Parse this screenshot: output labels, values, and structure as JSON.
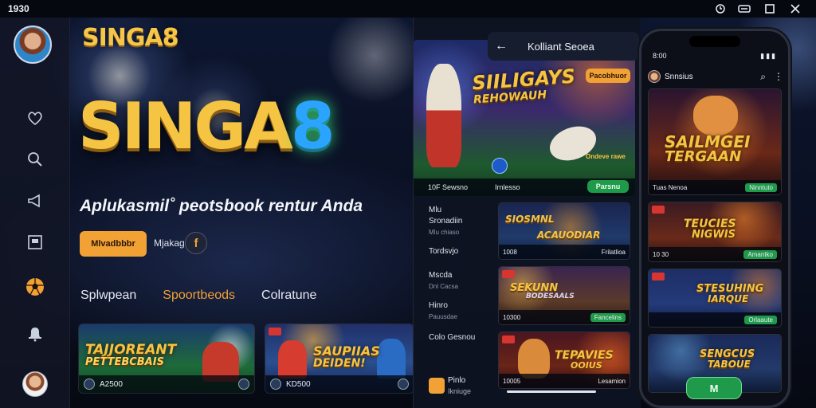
{
  "window": {
    "clock": "1930",
    "controls": [
      "history",
      "toggle",
      "maximize",
      "close"
    ]
  },
  "rail": {
    "icons": [
      "heart-icon",
      "search-icon",
      "megaphone-icon",
      "inbox-icon",
      "soccer-ball-icon",
      "bell-icon"
    ]
  },
  "hero": {
    "logo_small": "SINGA8",
    "logo_big_text": "SINGA",
    "logo_big_digit": "8",
    "tagline": "Aplukasmil˚ peotsbook rentur Anda",
    "cta_label": "Mlvadbbbr",
    "small_label": "Mjakag",
    "fb_glyph": "f"
  },
  "tabs": [
    {
      "label": "Splwpean",
      "active": false
    },
    {
      "label": "Spoortbeods",
      "active": true
    },
    {
      "label": "Colratune",
      "active": false
    }
  ],
  "cards": [
    {
      "title_line1": "TAJJOREANT",
      "title_line2": "PETTEBCBAIS",
      "footer": "A2500"
    },
    {
      "title_line1": "SAUPIIAS",
      "title_line2": "DEIDEN!",
      "footer": "KD500"
    }
  ],
  "panel": {
    "header_title": "Kolliant Seoea",
    "feature": {
      "title_line1": "SIILIGAYS",
      "title_line2": "REHOWAUH",
      "badge": "Pacobhuor",
      "promo": "Ondeve rawe",
      "footer_left": "10F Sewsno",
      "footer_mid": "Irnlesso",
      "button": "Parsnu"
    },
    "list": [
      {
        "label": "Mlu",
        "sub": ""
      },
      {
        "label": "Sronadiin",
        "sub": "Mlu chiaso"
      },
      {
        "label": "Tordsvjo",
        "sub": ""
      },
      {
        "label": "Mscda",
        "sub": "Dnl Cacsa"
      },
      {
        "label": "Hinro",
        "sub": "Pauusdae"
      },
      {
        "label": "Colo Gesnou",
        "sub": ""
      }
    ],
    "tiles": [
      {
        "title_line1": "SIOSMNL",
        "title_line2": "ACAUODIAR",
        "footer": "1008",
        "button": "Frilatlioa"
      },
      {
        "title_line1": "SEKUNN",
        "title_line2": "BODESAALS",
        "footer": "10300",
        "button": "Fancelins"
      },
      {
        "title_line1": "TEPAVIES",
        "title_line2": "OOIUS",
        "footer": "10005",
        "button": "Lesamion"
      }
    ],
    "bottom_label": "Pinlo",
    "bottom_sub": "Ikniuge"
  },
  "phone": {
    "status_time": "8:00",
    "signal": "▮▮▮",
    "app_name": "Snnsius",
    "tiles": [
      {
        "title_line1": "SAILMGEI",
        "title_line2": "TERGAAN",
        "footer": "Tuas Nenoa",
        "button": "Ninntuto"
      },
      {
        "title_line1": "TEUCIES",
        "title_line2": "NIGWIS",
        "footer": "10 30",
        "button": "Amantko"
      },
      {
        "title_line1": "STESUHING",
        "title_line2": "IARQUE",
        "footer": "",
        "button": "Orlaaute"
      },
      {
        "title_line1": "SENGCUS",
        "title_line2": "TABOUE",
        "footer": "",
        "button": ""
      }
    ],
    "fab_label": "M"
  },
  "colors": {
    "accent_orange": "#f2a135",
    "gold": "#f5c443",
    "green": "#1f9a4a",
    "bg": "#0a1022"
  }
}
